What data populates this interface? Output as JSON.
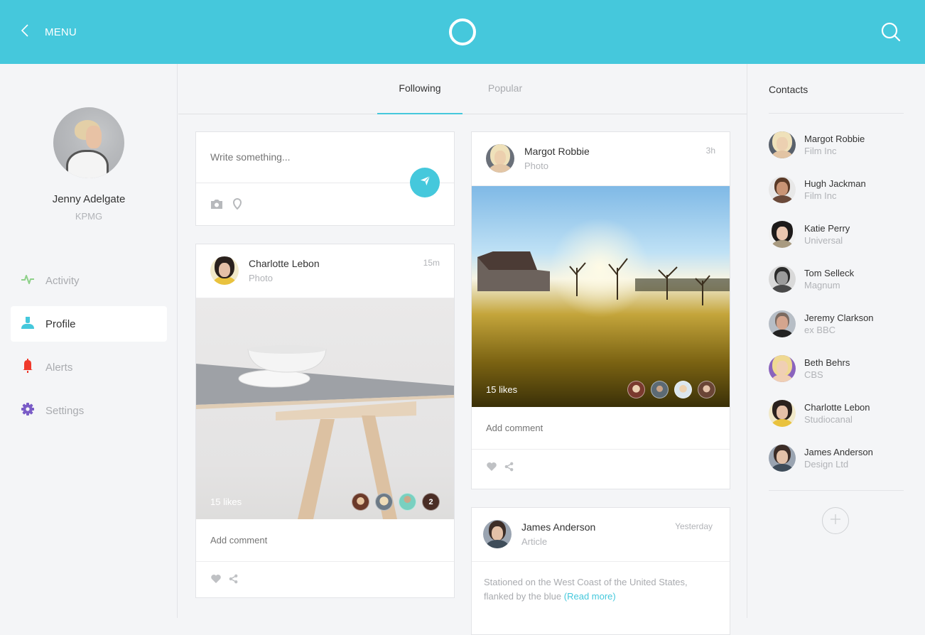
{
  "header": {
    "menu_label": "MENU",
    "back_icon": "chevron-left-icon",
    "logo_icon": "ring-logo-icon",
    "search_icon": "search-icon",
    "accent_color": "#45c8dc"
  },
  "profile": {
    "name": "Jenny Adelgate",
    "org": "KPMG"
  },
  "nav": {
    "items": [
      {
        "label": "Activity",
        "icon": "activity-pulse-icon",
        "color": "#8fd18a",
        "active": false
      },
      {
        "label": "Profile",
        "icon": "user-icon",
        "color": "#45c8dc",
        "active": true
      },
      {
        "label": "Alerts",
        "icon": "bell-icon",
        "color": "#f0392b",
        "active": false
      },
      {
        "label": "Settings",
        "icon": "gear-icon",
        "color": "#7a5cc7",
        "active": false
      }
    ]
  },
  "tabs": [
    {
      "label": "Following",
      "active": true
    },
    {
      "label": "Popular",
      "active": false
    }
  ],
  "composer": {
    "placeholder": "Write something...",
    "send_icon": "paper-plane-icon",
    "camera_icon": "camera-icon",
    "location_icon": "location-pin-icon"
  },
  "posts": [
    {
      "author": "Charlotte Lebon",
      "type": "Photo",
      "time": "15m",
      "likes": "15 likes",
      "extra_likers": "2",
      "comment_placeholder": "Add comment"
    },
    {
      "author": "Margot Robbie",
      "type": "Photo",
      "time": "3h",
      "likes": "15 likes",
      "comment_placeholder": "Add comment"
    },
    {
      "author": "James Anderson",
      "type": "Article",
      "time": "Yesterday",
      "text": "Stationed on the West Coast of the United States, flanked by the blue",
      "read_more": "(Read more)"
    }
  ],
  "contacts": {
    "title": "Contacts",
    "items": [
      {
        "name": "Margot Robbie",
        "org": "Film Inc"
      },
      {
        "name": "Hugh Jackman",
        "org": "Film Inc"
      },
      {
        "name": "Katie Perry",
        "org": "Universal"
      },
      {
        "name": "Tom Selleck",
        "org": "Magnum"
      },
      {
        "name": "Jeremy Clarkson",
        "org": "ex BBC"
      },
      {
        "name": "Beth Behrs",
        "org": "CBS"
      },
      {
        "name": "Charlotte Lebon",
        "org": "Studiocanal"
      },
      {
        "name": "James Anderson",
        "org": "Design Ltd"
      }
    ],
    "add_icon": "plus-icon"
  }
}
